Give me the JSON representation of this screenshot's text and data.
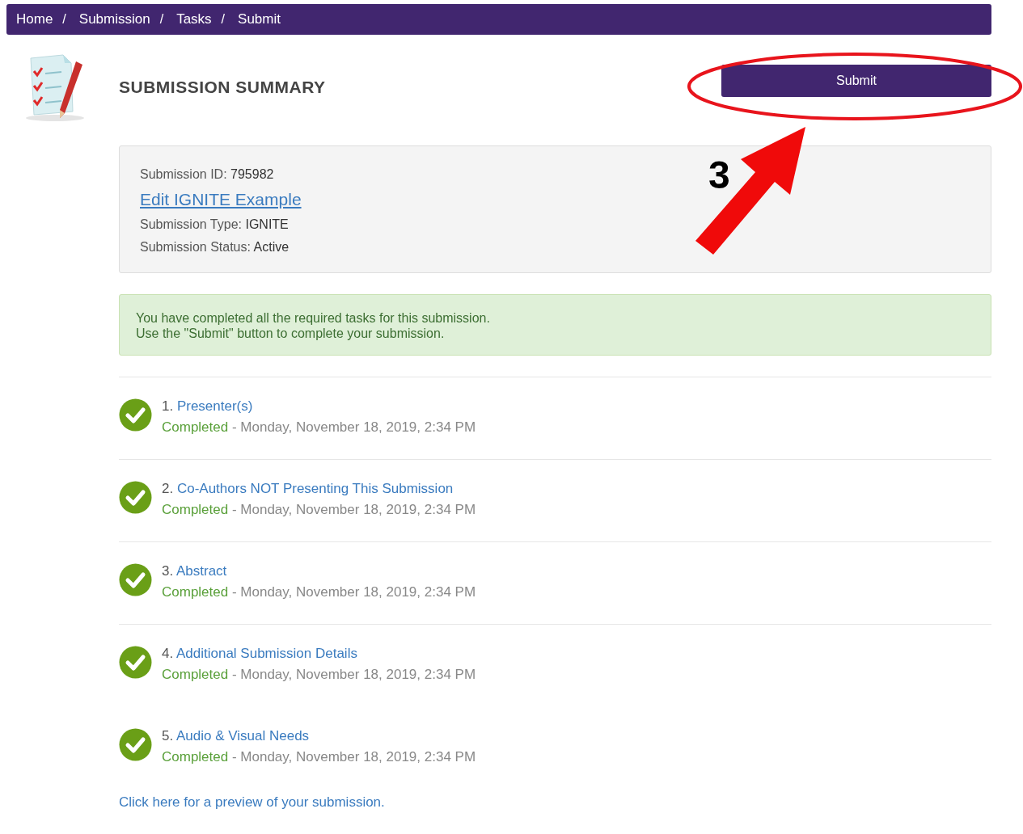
{
  "breadcrumb": [
    "Home",
    "Submission",
    "Tasks",
    "Submit"
  ],
  "breadcrumb_separators": [
    "/",
    "/",
    "/"
  ],
  "header": {
    "title": "SUBMISSION SUMMARY",
    "submit_button": "Submit"
  },
  "annotation": {
    "label": "3"
  },
  "summary": {
    "id_label": "Submission ID:",
    "id_value": "795982",
    "edit_link": "Edit IGNITE Example",
    "type_label": "Submission Type:",
    "type_value": "IGNITE",
    "status_label": "Submission Status:",
    "status_value": "Active"
  },
  "alert": [
    "You have completed all the required tasks for this submission.",
    "Use the \"Submit\" button to complete your submission."
  ],
  "tasks": [
    {
      "number": "1.",
      "title": "Presenter(s)",
      "status": "Completed",
      "date": "- Monday, November 18, 2019, 2:34 PM",
      "completed": true,
      "divider": true
    },
    {
      "number": "2.",
      "title": "Co-Authors NOT Presenting This Submission",
      "status": "Completed",
      "date": "- Monday, November 18, 2019, 2:34 PM",
      "completed": true,
      "divider": true
    },
    {
      "number": "3.",
      "title": "Abstract",
      "status": "Completed",
      "date": "- Monday, November 18, 2019, 2:34 PM",
      "completed": true,
      "divider": true
    },
    {
      "number": "4.",
      "title": "Additional Submission Details",
      "status": "Completed",
      "date": "- Monday, November 18, 2019, 2:34 PM",
      "completed": true,
      "divider": false
    },
    {
      "number": "5.",
      "title": "Audio & Visual Needs",
      "status": "Completed",
      "date": "- Monday, November 18, 2019, 2:34 PM",
      "completed": true,
      "divider": false
    }
  ],
  "preview_link": "Click here for a preview of your submission."
}
